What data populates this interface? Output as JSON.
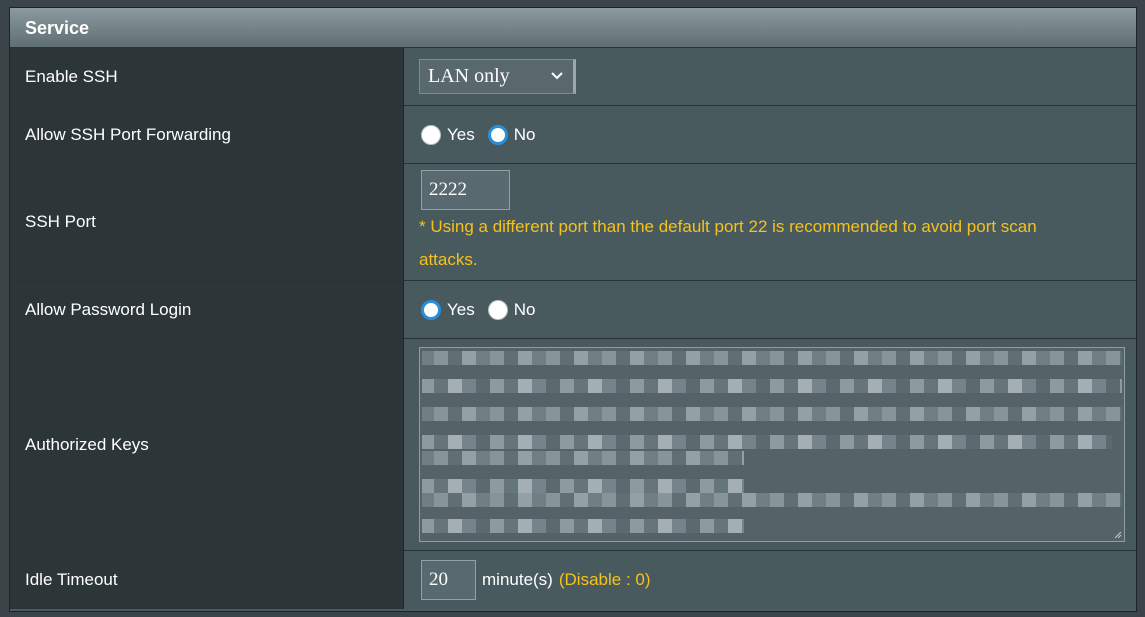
{
  "section": {
    "title": "Service"
  },
  "rows": {
    "enable_ssh": {
      "label": "Enable SSH",
      "selected": "LAN only"
    },
    "port_forwarding": {
      "label": "Allow SSH Port Forwarding",
      "options": [
        "Yes",
        "No"
      ],
      "selected": "No"
    },
    "ssh_port": {
      "label": "SSH Port",
      "value": "2222",
      "note": "* Using a different port than the default port 22 is recommended to avoid port scan attacks."
    },
    "password_login": {
      "label": "Allow Password Login",
      "options": [
        "Yes",
        "No"
      ],
      "selected": "Yes"
    },
    "authorized_keys": {
      "label": "Authorized Keys"
    },
    "idle_timeout": {
      "label": "Idle Timeout",
      "value": "20",
      "unit": "minute(s)",
      "hint": "(Disable : 0)"
    }
  },
  "colors": {
    "accent": "#2a8fd8",
    "note": "#f4c21a"
  }
}
